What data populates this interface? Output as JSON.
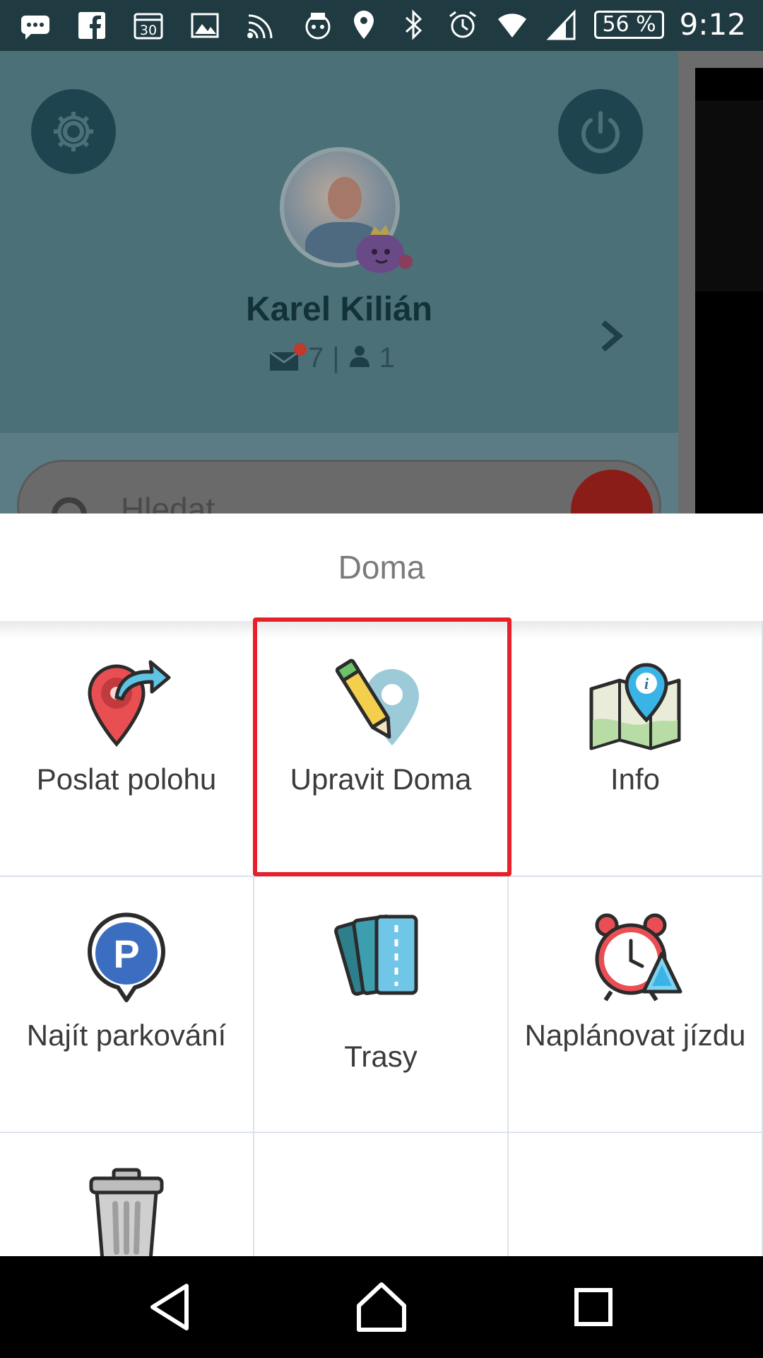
{
  "status_bar": {
    "left_icons": [
      "messages-icon",
      "facebook-icon",
      "calendar-icon",
      "gallery-icon",
      "cast-icon",
      "app-icon"
    ],
    "calendar_day": "30",
    "right_icons": [
      "location-icon",
      "bluetooth-icon",
      "alarm-icon",
      "wifi-icon",
      "signal-icon"
    ],
    "battery": "56 %",
    "time": "9:12"
  },
  "profile": {
    "name": "Karel Kilián",
    "messages_count": "7",
    "separator": "|",
    "friends_count": "1"
  },
  "search": {
    "placeholder": "Hledat"
  },
  "sheet": {
    "title": "Doma",
    "actions": [
      {
        "label": "Poslat polohu",
        "icon": "send-location-icon"
      },
      {
        "label": "Upravit Doma",
        "icon": "edit-pin-icon"
      },
      {
        "label": "Info",
        "icon": "map-info-icon"
      },
      {
        "label": "Najít parkování",
        "icon": "parking-icon"
      },
      {
        "label": "Trasy",
        "icon": "routes-icon"
      },
      {
        "label": "Naplánovat jízdu",
        "icon": "alarm-plan-icon"
      },
      {
        "label": "",
        "icon": "trash-icon"
      }
    ]
  },
  "colors": {
    "highlight": "#e8202a",
    "status_bar": "#1f3a40"
  }
}
